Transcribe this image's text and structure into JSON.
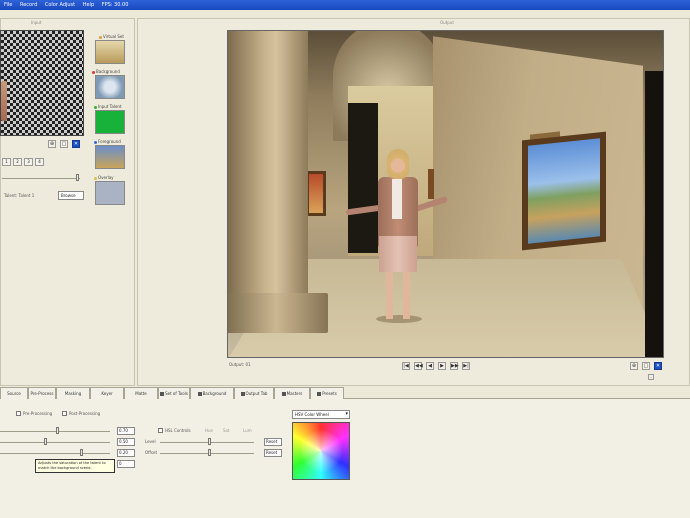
{
  "window": {
    "title_parts": [
      "File",
      "Record",
      "Color Adjust",
      "Help",
      "FPS: 30.00"
    ]
  },
  "input_panel": {
    "caption": "Input",
    "layers": [
      {
        "label": "Virtual Set",
        "color": "#d9a23a"
      },
      {
        "label": "Background",
        "color": "#d93a3a"
      },
      {
        "label": "Input Talent",
        "color": "#3ab03a"
      },
      {
        "label": "Foreground",
        "color": "#3a6ad9"
      },
      {
        "label": "Overlay",
        "color": "#d9c23a"
      }
    ],
    "row_buttons": [
      "1",
      "2",
      "3",
      "4"
    ],
    "talent_label": "Talent:",
    "talent_value": "Talent 1",
    "browse_label": "Browse"
  },
  "output_panel": {
    "caption": "Output",
    "status": "Output: 01",
    "transport": [
      "|◀",
      "◀◀",
      "◀",
      "▶",
      "▶▶",
      "▶|"
    ]
  },
  "tabs": [
    "Source",
    "Pre-Process",
    "Masking",
    "Keyer",
    "Matte",
    "Set of Tools",
    "Background",
    "Output Tab",
    "Masters",
    "Presets"
  ],
  "bottom": {
    "pre_processing": "Pre-Processing",
    "post_processing": "Post-Processing",
    "values": [
      "0.70",
      "0.50",
      "0.20",
      "0"
    ],
    "hsl_label": "HSL Controls",
    "hsl_fields": [
      "Hue",
      "Sat",
      "Lum"
    ],
    "hsl_rows": [
      "Level",
      "Offset"
    ],
    "reset_labels": [
      "Reset",
      "Reset"
    ],
    "select_value": "HSV Color Wheel",
    "tooltip_text": "Adjusts the saturation of the talent to match the background scene."
  }
}
